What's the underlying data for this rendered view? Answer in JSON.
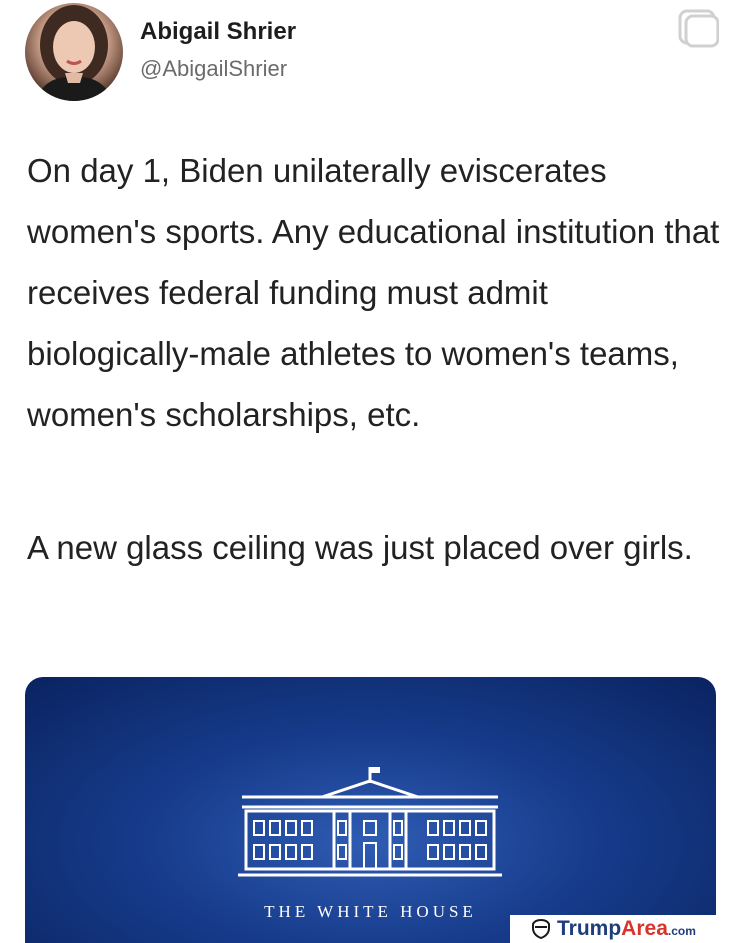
{
  "author": {
    "name": "Abigail Shrier",
    "handle": "@AbigailShrier"
  },
  "tweet": {
    "paragraph_1": "On day 1, Biden unilaterally eviscerates women's sports.  Any educational institution that receives federal funding must admit biologically-male athletes to women's teams, women's scholarships, etc.",
    "paragraph_2": "A new glass ceiling was just placed over girls."
  },
  "media_card": {
    "caption": "THE WHITE HOUSE",
    "background_color": "#173c8c"
  },
  "watermark": {
    "brand_part1": "Trump",
    "brand_part2": "Area",
    "brand_suffix": ".com",
    "icon": "shield-icon"
  },
  "icons": {
    "share": "share-icon"
  }
}
